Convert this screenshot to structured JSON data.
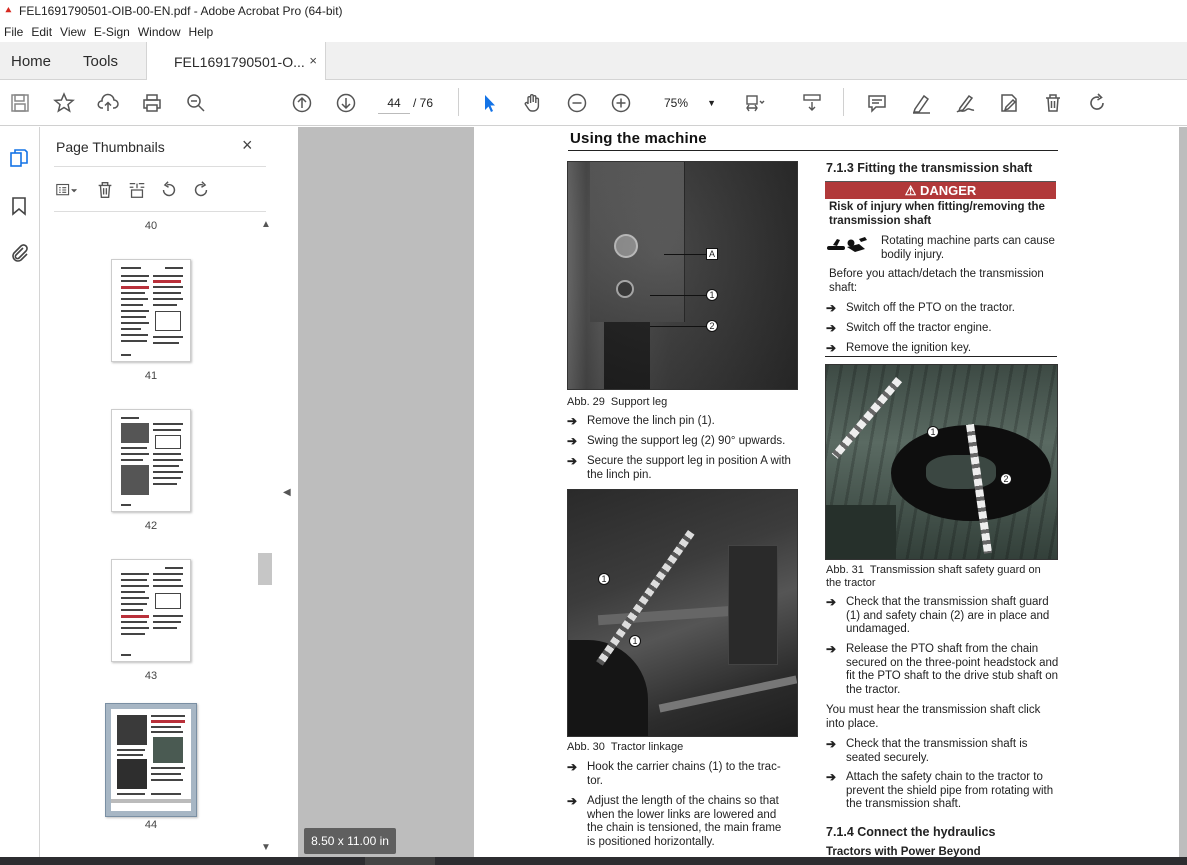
{
  "window": {
    "title": "FEL1691790501-OIB-00-EN.pdf - Adobe Acrobat Pro (64-bit)"
  },
  "menu": [
    "File",
    "Edit",
    "View",
    "E-Sign",
    "Window",
    "Help"
  ],
  "tabs": {
    "home": "Home",
    "tools": "Tools",
    "doc": "FEL1691790501-O...",
    "close": "×"
  },
  "toolbar": {
    "page_current": "44",
    "page_total": "/ 76",
    "zoom": "75%"
  },
  "thumbnails": {
    "title": "Page Thumbnails",
    "close": "×",
    "pages": [
      "40",
      "41",
      "42",
      "43",
      "44"
    ],
    "selected": "44"
  },
  "status": {
    "page_size": "8.50 x 11.00 in"
  },
  "doc": {
    "header": "Using the machine",
    "fig29": {
      "num": "Abb. 29",
      "title": "Support leg",
      "callouts": [
        "A",
        "1",
        "2"
      ]
    },
    "steps_a": [
      "Remove the linch pin (1).",
      "Swing the support leg (2) 90° upwards.",
      "Secure the support leg in position A with the linch pin."
    ],
    "fig30": {
      "num": "Abb. 30",
      "title": "Tractor linkage",
      "callouts": [
        "1",
        "1"
      ]
    },
    "steps_b": [
      "Hook the carrier chains (1) to the trac-tor.",
      "Adjust the length of the chains so that when the lower links are lowered and the chain is tensioned, the main frame is positioned horizontally."
    ],
    "sec713": "7.1.3   Fitting the transmission shaft",
    "danger_label": "DANGER",
    "danger_title": "Risk of injury when fitting/removing the transmission shaft",
    "danger_text": "Rotating machine parts can cause bodily injury.",
    "before": "Before you attach/detach the transmission shaft:",
    "steps_c": [
      "Switch off the PTO on the tractor.",
      "Switch off the tractor engine.",
      "Remove the ignition key."
    ],
    "fig31": {
      "num": "Abb. 31",
      "title": "Transmission shaft safety guard on the tractor",
      "callouts": [
        "1",
        "2"
      ]
    },
    "steps_d": [
      "Check that the transmission shaft guard (1) and safety chain (2) are in place and undamaged.",
      "Release the PTO shaft from the chain secured on the three-point headstock and fit the PTO shaft to the drive stub shaft on the tractor."
    ],
    "click_note": "You must hear the transmission shaft click into place.",
    "steps_e": [
      "Check that the transmission shaft is seated securely.",
      "Attach the safety chain to the tractor to prevent the shield pipe from rotating with the transmission shaft."
    ],
    "sec714": "7.1.4   Connect the hydraulics",
    "tractors": "Tractors with Power Beyond",
    "arrow": "➔"
  },
  "colors": {
    "danger": "#b1393a",
    "active": "#1473e6",
    "docbg": "#bdbdbd"
  }
}
